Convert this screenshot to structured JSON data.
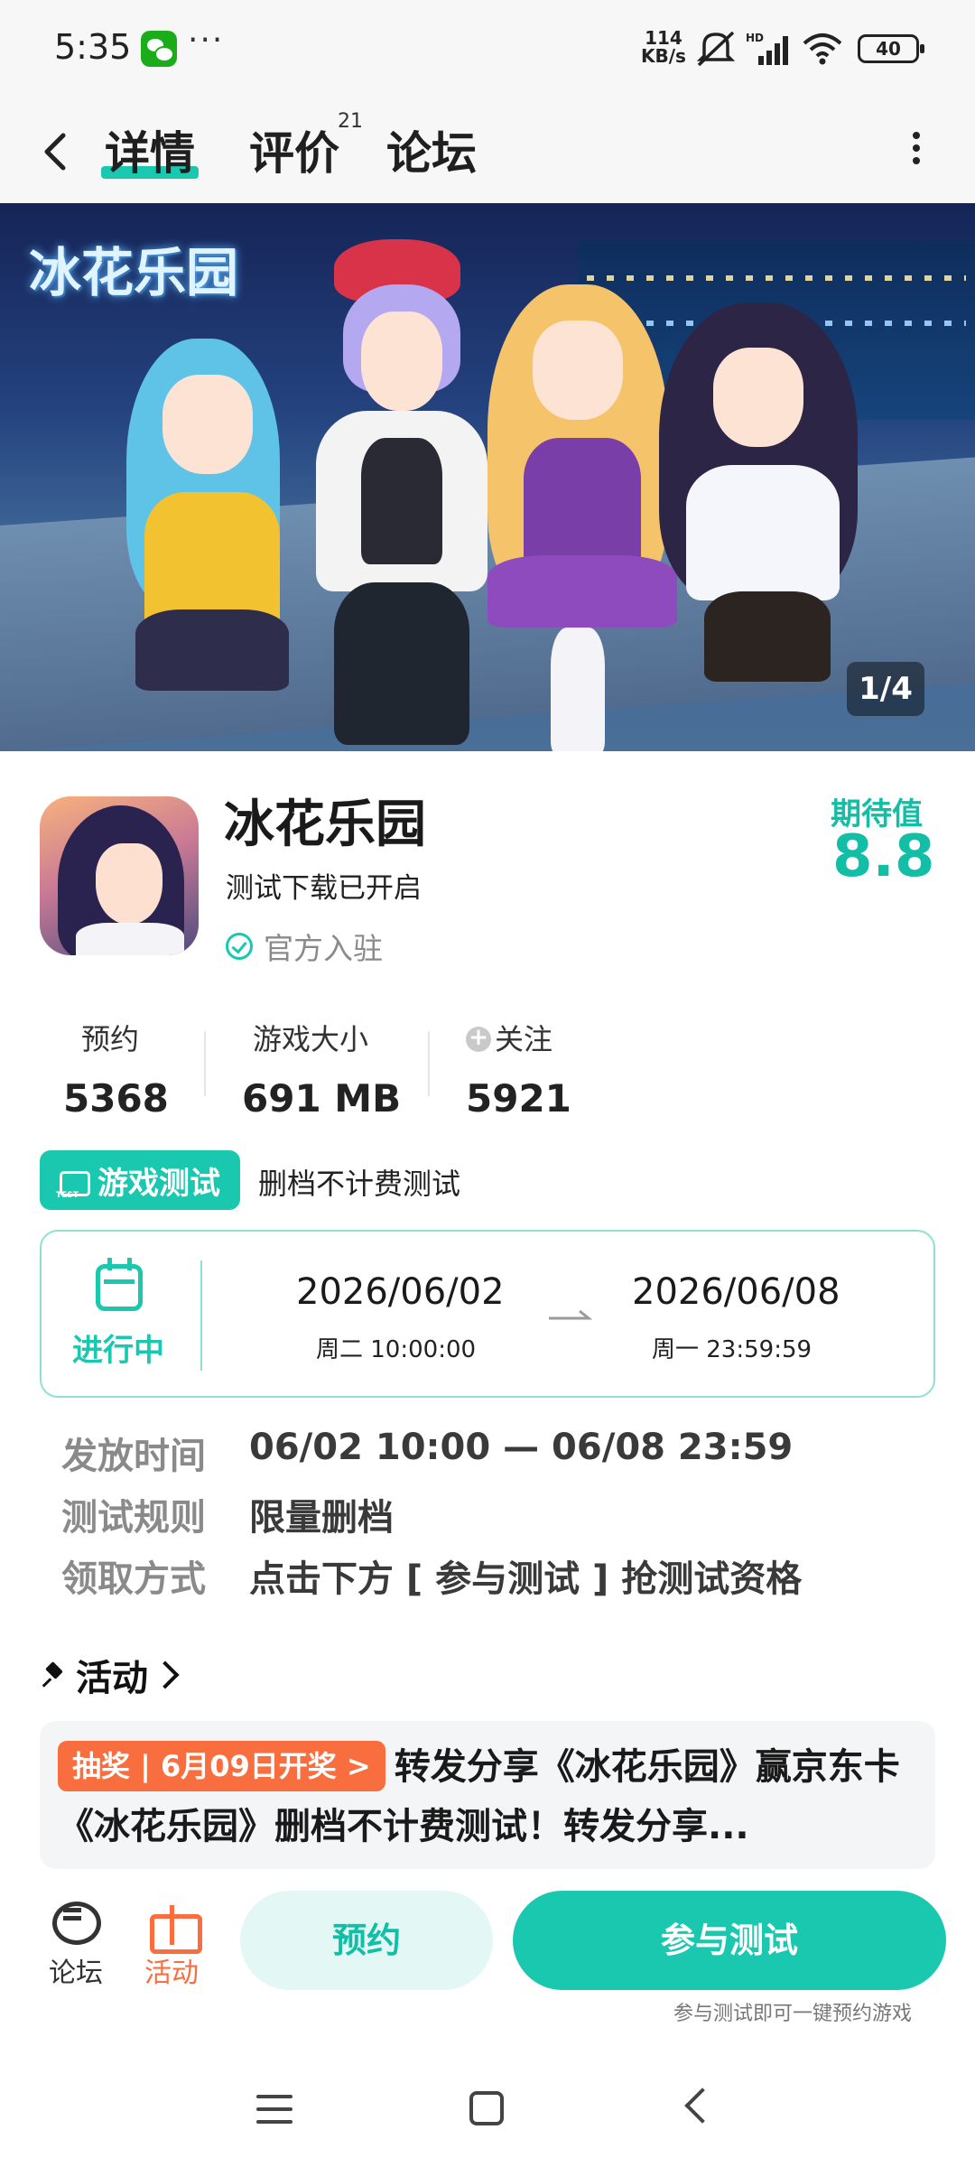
{
  "status_bar": {
    "time": "5:35",
    "dots": "···",
    "net_speed_value": "114",
    "net_speed_unit": "KB/s",
    "signal_label": "HD",
    "battery": "40"
  },
  "nav": {
    "tabs": [
      {
        "label": "详情",
        "active": true
      },
      {
        "label": "评价",
        "badge": "21"
      },
      {
        "label": "论坛"
      }
    ]
  },
  "hero": {
    "logo_text": "冰花乐园",
    "page_indicator": "1/4"
  },
  "game": {
    "title": "冰花乐园",
    "subtitle": "测试下载已开启",
    "official": "官方入驻",
    "expect_label": "期待值",
    "expect_value": "8.8"
  },
  "stats": [
    {
      "label": "预约",
      "value": "5368"
    },
    {
      "label": "游戏大小",
      "value": "691 MB"
    },
    {
      "label": "关注",
      "value": "5921"
    }
  ],
  "test": {
    "badge": "游戏测试",
    "description": "删档不计费测试",
    "status": "进行中",
    "start_date": "2026/06/02",
    "start_time": "周二  10:00:00",
    "end_date": "2026/06/08",
    "end_time": "周一  23:59:59"
  },
  "details": [
    {
      "label": "发放时间",
      "value": "06/02 10:00 — 06/08 23:59"
    },
    {
      "label": "测试规则",
      "value": "限量删档"
    },
    {
      "label": "领取方式",
      "value": "点击下方 [ 参与测试 ] 抢测试资格"
    }
  ],
  "activity": {
    "title": "活动",
    "tag": "抽奖 | 6月09日开奖 >",
    "text": "转发分享《冰花乐园》赢京东卡 《冰花乐园》删档不计费测试！转发分享..."
  },
  "bottom": {
    "forum_label": "论坛",
    "activity_label": "活动",
    "reserve_label": "预约",
    "join_label": "参与测试",
    "join_hint": "参与测试即可一键预约游戏"
  },
  "colors": {
    "accent": "#1ac8b0",
    "activity_tag": "#f96e3f",
    "activity_icon": "#f96e3f"
  }
}
